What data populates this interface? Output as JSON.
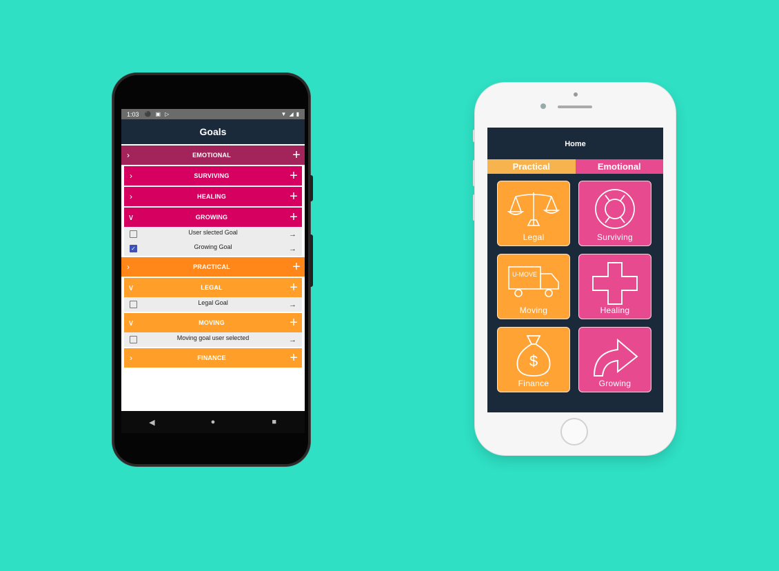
{
  "colors": {
    "background": "#2fe0c4",
    "appbar": "#1b2a3b",
    "emotional_top": "#a3235b",
    "emotional_sub": "#d5005f",
    "practical_top": "#ff8618",
    "practical_sub": "#ff9f2a",
    "tile_orange": "#ffa335",
    "tile_pink": "#e84a8f",
    "tab_practical": "#f7b34d",
    "tab_emotional": "#e84a8f"
  },
  "android": {
    "status": {
      "time": "1:03",
      "left_icons": [
        "shield-icon",
        "sd-card-icon",
        "play-store-icon"
      ],
      "right_icons": [
        "wifi-icon",
        "signal-icon",
        "battery-icon"
      ]
    },
    "title": "Goals",
    "rows": [
      {
        "kind": "category",
        "level": "top",
        "label": "EMOTIONAL",
        "color": "#a3235b",
        "expanded": false
      },
      {
        "kind": "category",
        "level": "sub",
        "label": "SURVIVING",
        "color": "#d5005f",
        "expanded": false
      },
      {
        "kind": "category",
        "level": "sub",
        "label": "HEALING",
        "color": "#d5005f",
        "expanded": false
      },
      {
        "kind": "category",
        "level": "sub",
        "label": "GROWING",
        "color": "#d5005f",
        "expanded": true
      },
      {
        "kind": "goal",
        "label": "User slected Goal",
        "checked": false
      },
      {
        "kind": "goal",
        "label": "Growing Goal",
        "checked": true
      },
      {
        "kind": "category",
        "level": "top",
        "label": "PRACTICAL",
        "color": "#ff8618",
        "expanded": false
      },
      {
        "kind": "category",
        "level": "sub",
        "label": "LEGAL",
        "color": "#ff9f2a",
        "expanded": true
      },
      {
        "kind": "goal",
        "label": "Legal Goal",
        "checked": false
      },
      {
        "kind": "category",
        "level": "sub",
        "label": "MOVING",
        "color": "#ff9f2a",
        "expanded": true
      },
      {
        "kind": "goal",
        "label": "Moving goal user selected",
        "checked": false
      },
      {
        "kind": "category",
        "level": "sub",
        "label": "FINANCE",
        "color": "#ff9f2a",
        "expanded": false
      }
    ],
    "nav": [
      "back-icon",
      "home-icon",
      "recents-icon"
    ]
  },
  "iphone": {
    "title": "Home",
    "tabs": [
      {
        "label": "Practical",
        "color": "#f7b34d"
      },
      {
        "label": "Emotional",
        "color": "#e84a8f"
      }
    ],
    "tiles": [
      {
        "label": "Legal",
        "icon": "scales-icon",
        "color": "#ffa335"
      },
      {
        "label": "Surviving",
        "icon": "lifebuoy-icon",
        "color": "#e84a8f"
      },
      {
        "label": "Moving",
        "icon": "truck-icon",
        "color": "#ffa335",
        "icon_text": "U-MOVE"
      },
      {
        "label": "Healing",
        "icon": "cross-icon",
        "color": "#e84a8f"
      },
      {
        "label": "Finance",
        "icon": "money-bag-icon",
        "color": "#ffa335",
        "icon_text": "$"
      },
      {
        "label": "Growing",
        "icon": "curved-arrow-icon",
        "color": "#e84a8f"
      }
    ]
  }
}
